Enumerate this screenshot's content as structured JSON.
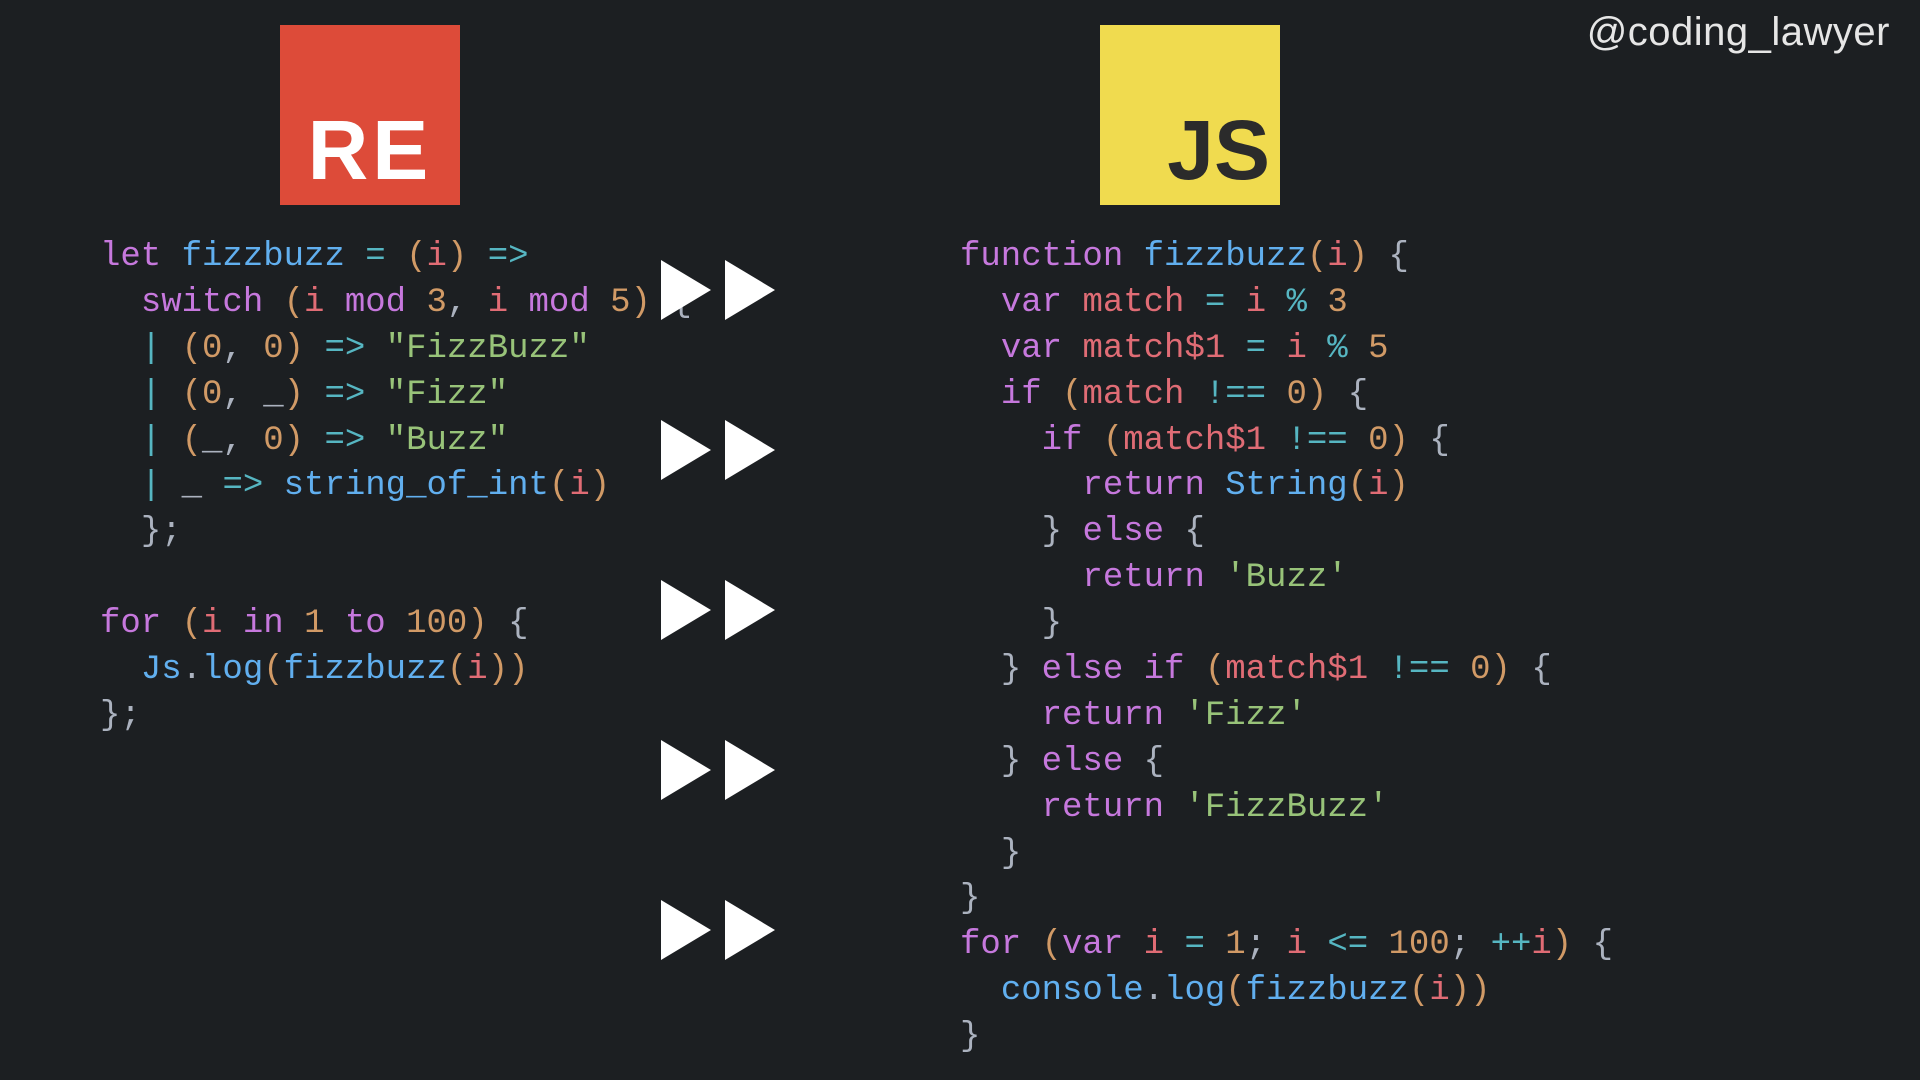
{
  "handle": "@coding_lawyer",
  "logos": {
    "re": "RE",
    "js": "JS"
  },
  "tokens": {
    "let": "let",
    "switch": "switch",
    "mod": "mod",
    "for": "for",
    "in": "in",
    "to": "to",
    "function": "function",
    "var": "var",
    "if": "if",
    "else": "else",
    "return": "return",
    "fizzbuzz": "fizzbuzz",
    "i": "i",
    "match": "match",
    "match1": "match$1",
    "String": "String",
    "Js": "Js",
    "log": "log",
    "console": "console",
    "string_of_int": "string_of_int"
  },
  "nums": {
    "0": "0",
    "1": "1",
    "3": "3",
    "5": "5",
    "100": "100"
  },
  "strs": {
    "FizzBuzz_dq": "\"FizzBuzz\"",
    "Fizz_dq": "\"Fizz\"",
    "Buzz_dq": "\"Buzz\"",
    "Buzz_sq": "'Buzz'",
    "Fizz_sq": "'Fizz'",
    "FizzBuzz_sq": "'FizzBuzz'"
  },
  "sym": {
    "eq": "=",
    "arrow": "=>",
    "comma": ",",
    "pipe": "|",
    "under": "_",
    "lpar": "(",
    "rpar": ")",
    "lbrace": "{",
    "rbrace": "}",
    "semi": ";",
    "dot": ".",
    "pct": "%",
    "neq": "!==",
    "lte": "<=",
    "pp": "++"
  }
}
